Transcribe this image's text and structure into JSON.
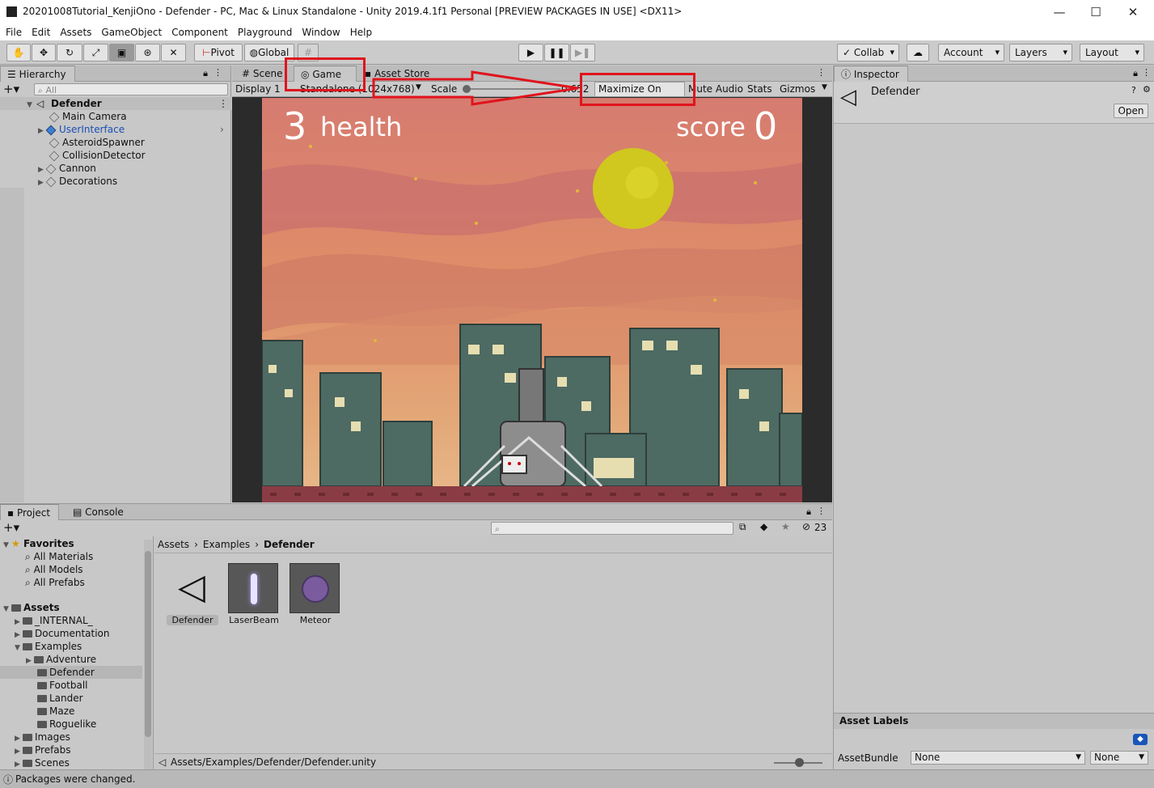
{
  "window": {
    "title": "20201008Tutorial_KenjiOno - Defender - PC, Mac & Linux Standalone - Unity 2019.4.1f1 Personal [PREVIEW PACKAGES IN USE] <DX11>",
    "minimize": "—",
    "maximize": "☐",
    "close": "✕"
  },
  "menu": [
    "File",
    "Edit",
    "Assets",
    "GameObject",
    "Component",
    "Playground",
    "Window",
    "Help"
  ],
  "toolbar": {
    "tools": [
      "hand-icon",
      "move-icon",
      "rotate-icon",
      "scale-icon",
      "rect-icon",
      "transform-icon",
      "custom-tool-icon"
    ],
    "pivot": "Pivot",
    "global": "Global",
    "collab": "Collab",
    "account": "Account",
    "layers": "Layers",
    "layout": "Layout"
  },
  "hierarchy": {
    "tab": "Hierarchy",
    "search_placeholder": "All",
    "scene": "Defender",
    "items": [
      "Main Camera",
      "UserInterface",
      "AsteroidSpawner",
      "CollisionDetector",
      "Cannon",
      "Decorations"
    ]
  },
  "center_tabs": {
    "scene": "Scene",
    "game": "Game",
    "asset_store": "Asset Store"
  },
  "game_bar": {
    "display": "Display 1",
    "resolution": "Standalone (1024x768)",
    "scale_label": "Scale",
    "scale_value": "0.652",
    "maximize": "Maximize On Play",
    "mute": "Mute Audio",
    "stats": "Stats",
    "gizmos": "Gizmos"
  },
  "game_view": {
    "health_value": "3",
    "health_label": "health",
    "score_label": "score",
    "score_value": "0"
  },
  "inspector": {
    "tab": "Inspector",
    "object": "Defender",
    "open_button": "Open",
    "asset_labels": "Asset Labels",
    "asset_bundle_label": "AssetBundle",
    "bundle_value": "None",
    "variant_value": "None"
  },
  "project": {
    "tab": "Project",
    "console_tab": "Console",
    "hidden_count": "23",
    "breadcrumb": [
      "Assets",
      "Examples",
      "Defender"
    ],
    "favorites_label": "Favorites",
    "favorites": [
      "All Materials",
      "All Models",
      "All Prefabs"
    ],
    "assets_label": "Assets",
    "tree": [
      "_INTERNAL_",
      "Documentation",
      "Examples",
      "Adventure",
      "Defender",
      "Football",
      "Lander",
      "Maze",
      "Roguelike",
      "Images",
      "Prefabs",
      "Scenes"
    ],
    "assets": [
      "Defender",
      "LaserBeam",
      "Meteor"
    ],
    "path": "Assets/Examples/Defender/Defender.unity"
  },
  "status": {
    "message": "Packages were changed."
  },
  "annotation_color": "#e0141c"
}
